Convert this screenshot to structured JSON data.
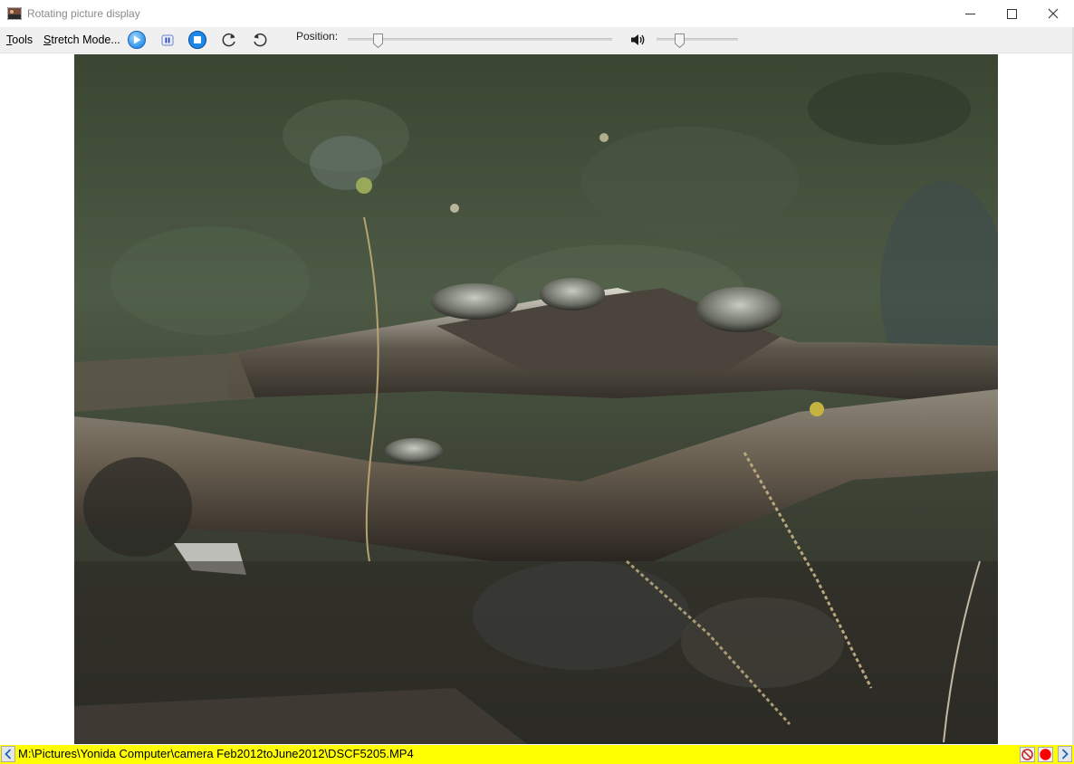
{
  "window": {
    "title": "Rotating picture display"
  },
  "toolbar": {
    "menus": [
      {
        "label": "Tools",
        "accel": "T"
      },
      {
        "label": "Stretch Mode...",
        "accel": "S"
      }
    ],
    "position_label": "Position:",
    "position_value": 0.1,
    "volume_value": 0.25
  },
  "icons": [
    "app-icon",
    "play-icon",
    "pause-icon",
    "stop-icon",
    "rotate-clockwise-icon",
    "rotate-counterclockwise-icon",
    "speaker-icon",
    "prev-arrow-icon",
    "next-arrow-icon",
    "no-entry-icon",
    "record-dot-icon"
  ],
  "colors": {
    "status_bar": "#ffff00",
    "accent_blue": "#1e88e5",
    "record_red": "#ff0000"
  },
  "status": {
    "file_path": "M:\\Pictures\\Yonida Computer\\camera Feb2012toJune2012\\DSCF5205.MP4"
  }
}
